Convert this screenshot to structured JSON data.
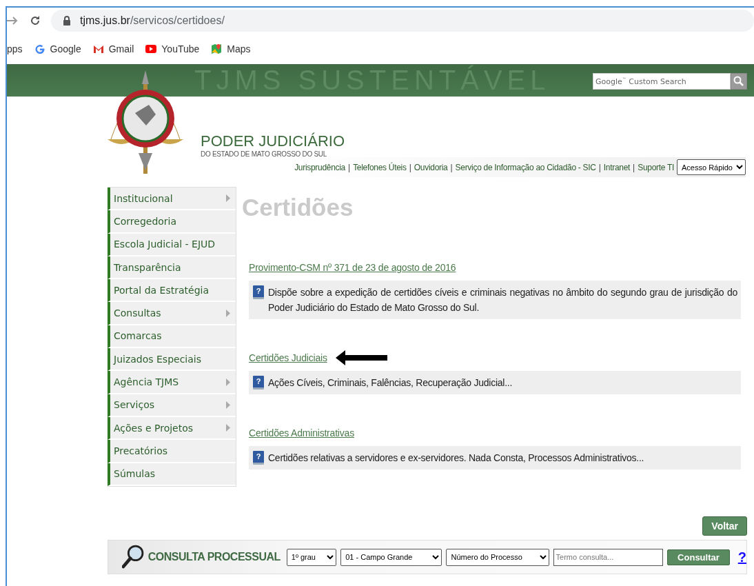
{
  "browser": {
    "url_domain": "tjms.jus.br",
    "url_path": "/servicos/certidoes/",
    "bookmarks": [
      {
        "label": "pps",
        "kind": "apps"
      },
      {
        "label": "Google",
        "kind": "google"
      },
      {
        "label": "Gmail",
        "kind": "gmail"
      },
      {
        "label": "YouTube",
        "kind": "youtube"
      },
      {
        "label": "Maps",
        "kind": "maps"
      }
    ]
  },
  "banner": {
    "title": "TJMS SUSTENTÁVEL",
    "search_placeholder": "Google$^{™}$ Custom Search"
  },
  "header": {
    "org": "PODER JUDICIÁRIO",
    "org_sub": "DO ESTADO DE MATO GROSSO DO SUL",
    "separator": "|",
    "links": [
      "Jurisprudência",
      "Telefones Úteis",
      "Ouvidoria",
      "Serviço de Informação ao Cidadão - SIC",
      "Intranet",
      "Suporte TI"
    ],
    "quick_access": "Acesso Rápido"
  },
  "sidebar": {
    "items": [
      {
        "label": "Institucional",
        "has_submenu": true
      },
      {
        "label": "Corregedoria",
        "has_submenu": false
      },
      {
        "label": "Escola Judicial - EJUD",
        "has_submenu": false
      },
      {
        "label": "Transparência",
        "has_submenu": false
      },
      {
        "label": "Portal da Estratégia",
        "has_submenu": false
      },
      {
        "label": "Consultas",
        "has_submenu": true
      },
      {
        "label": "Comarcas",
        "has_submenu": false
      },
      {
        "label": "Juizados Especiais",
        "has_submenu": false
      },
      {
        "label": "Agência TJMS",
        "has_submenu": true
      },
      {
        "label": "Serviços",
        "has_submenu": true
      },
      {
        "label": "Ações e Projetos",
        "has_submenu": true
      },
      {
        "label": "Precatórios",
        "has_submenu": false
      },
      {
        "label": "Súmulas",
        "has_submenu": false
      }
    ]
  },
  "page": {
    "title": "Certidões",
    "help_icon": "?",
    "sections": [
      {
        "link": "Provimento-CSM nº 371 de 23 de agosto de 2016",
        "description": "Dispõe sobre a expedição de certidões cíveis e criminais negativas no âmbito do segundo grau de jurisdição do Poder Judiciário do Estado de Mato Grosso do Sul.",
        "marked": false
      },
      {
        "link": "Certidões Judiciais",
        "description": "Ações Cíveis, Criminais, Falências, Recuperação Judicial...",
        "marked": true
      },
      {
        "link": "Certidões Administrativas",
        "description": "Certidões relativas a servidores e ex-servidores. Nada Consta, Processos Administrativos...",
        "marked": false
      }
    ],
    "back_button": "Voltar"
  },
  "consulta": {
    "title": "CONSULTA PROCESSUAL",
    "grau": "1º grau",
    "comarca": "01 - Campo Grande",
    "tipo": "Número do Processo",
    "term_placeholder": "Termo consulta...",
    "button": "Consultar",
    "help": "?"
  }
}
